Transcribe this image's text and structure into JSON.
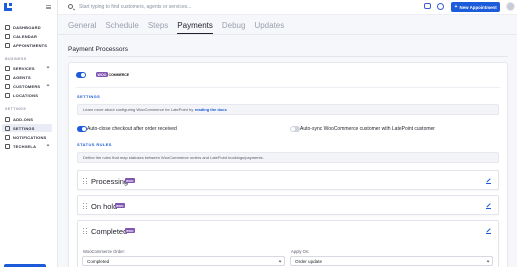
{
  "sidebar": {
    "items": [
      {
        "label": "DASHBOARD"
      },
      {
        "label": "CALENDAR"
      },
      {
        "label": "APPOINTMENTS"
      },
      {
        "label": "SERVICES"
      },
      {
        "label": "AGENTS"
      },
      {
        "label": "CUSTOMERS"
      },
      {
        "label": "LOCATIONS"
      },
      {
        "label": "ADD-ONS"
      },
      {
        "label": "SETTINGS"
      },
      {
        "label": "NOTIFICATIONS"
      },
      {
        "label": "TECHXELA"
      }
    ],
    "sections": [
      "BUSINESS",
      "SETTINGS"
    ]
  },
  "topbar": {
    "search_placeholder": "Start typing to find customers, agents or services...",
    "new_button_label": "New Appointment"
  },
  "tabs": [
    "General",
    "Schedule",
    "Steps",
    "Payments",
    "Debug",
    "Updates"
  ],
  "active_tab": "Payments",
  "page": {
    "title": "Payment Processors",
    "processor_logo_badge": "WOO",
    "processor_logo_text": "COMMERCE"
  },
  "settings": {
    "label": "SETTINGS",
    "info_text": "Learn more about configuring WooCommerce for LatePoint by",
    "info_link": "reading the docs",
    "option_autoclose": "Auto-close checkout after order received",
    "option_autosync": "Auto-sync WooCommerce customer with LatePoint customer"
  },
  "status_rules": {
    "label": "STATUS RULES",
    "info_text": "Define the rules that map statuses between WooCommerce orders and LatePoint bookings/payments.",
    "rules": [
      {
        "title": "Processing",
        "badge": "WOO"
      },
      {
        "title": "On hold",
        "badge": "WOO"
      },
      {
        "title": "Completed",
        "badge": "WOO"
      }
    ],
    "expanded": {
      "woo_order_label": "WooCommerce Order:",
      "woo_order_value": "Completed",
      "apply_on_label": "Apply On:",
      "apply_on_value": "Order update"
    }
  },
  "colors": {
    "accent": "#1c5bd9",
    "woo_purple": "#7f54b3"
  }
}
